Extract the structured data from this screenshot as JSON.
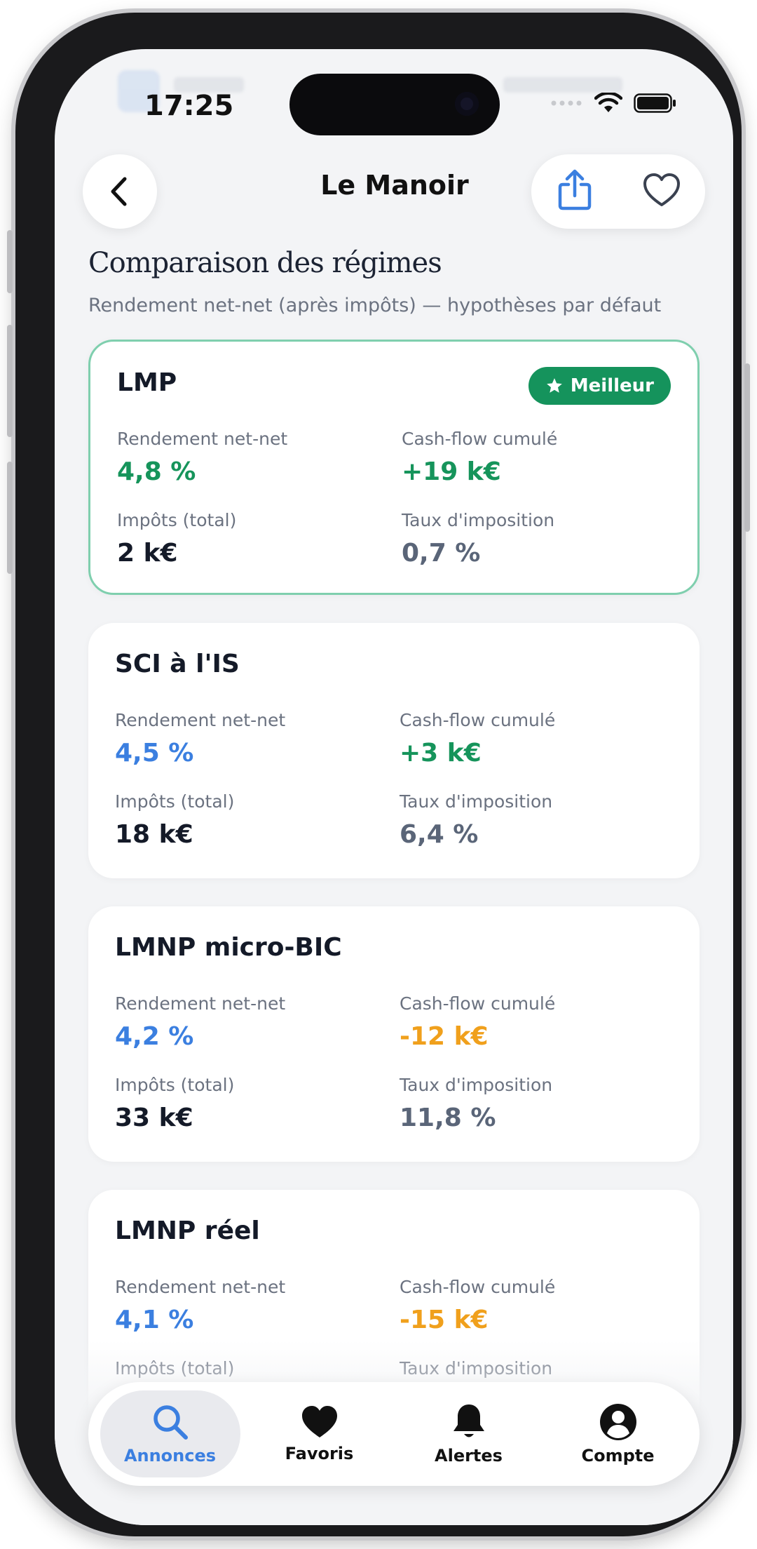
{
  "status": {
    "time": "17:25"
  },
  "nav": {
    "title": "Le Manoir"
  },
  "section": {
    "title": "Comparaison des régimes",
    "subtitle": "Rendement net-net (après impôts) — hypothèses par défaut"
  },
  "labels": {
    "yield": "Rendement net-net",
    "cashflow": "Cash-flow cumulé",
    "taxes": "Impôts (total)",
    "rate": "Taux d'imposition"
  },
  "cards": [
    {
      "name": "LMP",
      "badge": "Meilleur",
      "yield": "4,8 %",
      "cashflow": "+19 k€",
      "taxes": "2 k€",
      "rate": "0,7 %"
    },
    {
      "name": "SCI à l'IS",
      "yield": "4,5 %",
      "cashflow": "+3 k€",
      "taxes": "18 k€",
      "rate": "6,4 %"
    },
    {
      "name": "LMNP micro-BIC",
      "yield": "4,2 %",
      "cashflow": "-12 k€",
      "taxes": "33 k€",
      "rate": "11,8 %"
    },
    {
      "name": "LMNP réel",
      "yield": "4,1 %",
      "cashflow": "-15 k€",
      "taxes": "",
      "rate": ""
    }
  ],
  "colors": {
    "accent": "#3b7fe0",
    "best": "#15935c",
    "positive": "#16945b",
    "negative": "#f0a01c"
  },
  "tabs": [
    {
      "label": "Annonces",
      "icon": "search-icon",
      "active": true
    },
    {
      "label": "Favoris",
      "icon": "heart-filled-icon"
    },
    {
      "label": "Alertes",
      "icon": "bell-icon"
    },
    {
      "label": "Compte",
      "icon": "account-icon"
    }
  ]
}
